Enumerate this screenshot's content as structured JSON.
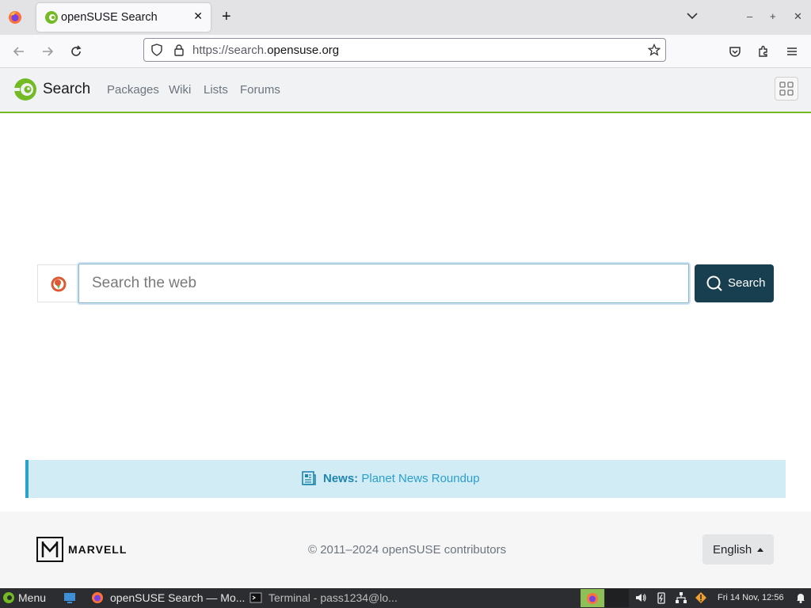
{
  "browser": {
    "tab_title": "openSUSE Search",
    "tab_close": "✕",
    "new_tab": "+",
    "url_prefix": "https://search.",
    "url_domain": "opensuse.org",
    "window_controls": [
      "–",
      "+",
      "✕"
    ]
  },
  "site": {
    "title": "Search",
    "nav": [
      "Packages",
      "Wiki",
      "Lists",
      "Forums"
    ],
    "accent_color": "#73ba25"
  },
  "search": {
    "placeholder": "Search the web",
    "value": "",
    "button_label": "Search",
    "engine_icon": "duckduckgo-icon"
  },
  "news": {
    "label": "News:",
    "text": "Planet News Roundup"
  },
  "footer": {
    "sponsor": "MARVELL",
    "copyright": "© 2011–2024 openSUSE contributors",
    "language": "English"
  },
  "taskbar": {
    "menu": "Menu",
    "windows": [
      "openSUSE Search — Mo...",
      "Terminal - pass1234@lo..."
    ],
    "clock": "Fri 14 Nov, 12:56"
  },
  "icons": {
    "browser": "firefox-icon",
    "back": "back-arrow-icon",
    "forward": "forward-arrow-icon",
    "reload": "reload-icon",
    "shield": "tracking-shield-icon",
    "lock": "lock-icon",
    "bookmark": "star-icon",
    "pocket": "pocket-icon",
    "extensions": "puzzle-icon",
    "menu": "hamburger-icon",
    "apps": "app-grid-icon"
  }
}
